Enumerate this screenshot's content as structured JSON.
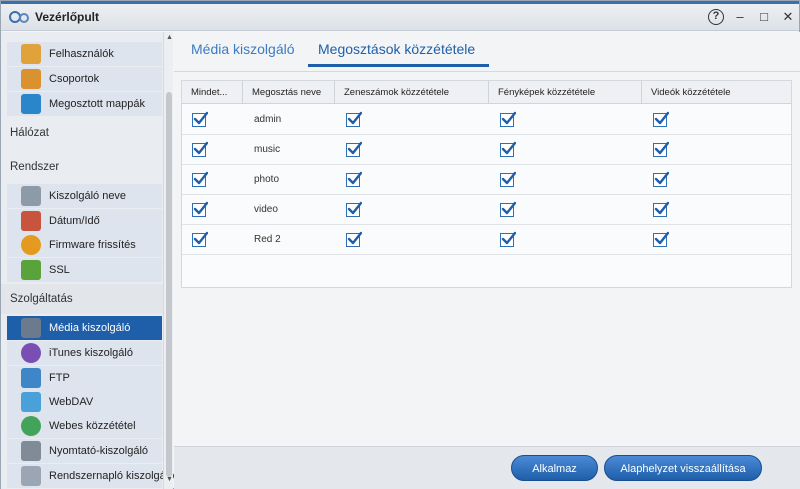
{
  "window": {
    "title": "Vezérlőpult"
  },
  "titlebar": {
    "help": "?",
    "minimize": "–",
    "maximize": "□",
    "close": "✕"
  },
  "sidebar": {
    "group_users": [
      {
        "label": "Felhasználók",
        "icon": "user-icon",
        "color": "#e0a23a"
      },
      {
        "label": "Csoportok",
        "icon": "group-icon",
        "color": "#d9922f"
      },
      {
        "label": "Megosztott mappák",
        "icon": "shared-folder-icon",
        "color": "#2a86c9"
      }
    ],
    "section_network": "Hálózat",
    "section_system": "Rendszer",
    "group_system": [
      {
        "label": "Kiszolgáló neve",
        "icon": "server-name-icon",
        "color": "#8d9aa8"
      },
      {
        "label": "Dátum/Idő",
        "icon": "calendar-icon",
        "color": "#c8533f"
      },
      {
        "label": "Firmware frissítés",
        "icon": "firmware-update-icon",
        "color": "#e39a1e"
      },
      {
        "label": "SSL",
        "icon": "ssl-certificate-icon",
        "color": "#5aa23a"
      }
    ],
    "section_services": "Szolgáltatás",
    "group_services": [
      {
        "label": "Média kiszolgáló",
        "icon": "media-server-icon",
        "color": "#6b7a8c",
        "active": true
      },
      {
        "label": "iTunes kiszolgáló",
        "icon": "itunes-icon",
        "color": "#7a4fb3"
      },
      {
        "label": "FTP",
        "icon": "ftp-icon",
        "color": "#3f86c8"
      },
      {
        "label": "WebDAV",
        "icon": "webdav-icon",
        "color": "#4aa0d8"
      },
      {
        "label": "Webes közzététel",
        "icon": "web-publishing-icon",
        "color": "#43a35a"
      },
      {
        "label": "Nyomtató-kiszolgáló",
        "icon": "printer-icon",
        "color": "#7f8b97"
      },
      {
        "label": "Rendszernapló kiszolgáló",
        "icon": "syslog-icon",
        "color": "#9aa6b3"
      }
    ]
  },
  "tabs": [
    {
      "label": "Média kiszolgáló"
    },
    {
      "label": "Megosztások közzététele"
    }
  ],
  "table": {
    "headers": [
      "Mindet...",
      "Megosztás neve",
      "Zeneszámok közzététele",
      "Fényképek közzététele",
      "Videók közzététele"
    ],
    "rows": [
      {
        "all": true,
        "name": "admin",
        "music": true,
        "photos": true,
        "videos": true
      },
      {
        "all": true,
        "name": "music",
        "music": true,
        "photos": true,
        "videos": true
      },
      {
        "all": true,
        "name": "photo",
        "music": true,
        "photos": true,
        "videos": true
      },
      {
        "all": true,
        "name": "video",
        "music": true,
        "photos": true,
        "videos": true
      },
      {
        "all": true,
        "name": "Red 2",
        "music": true,
        "photos": true,
        "videos": true
      }
    ]
  },
  "footer": {
    "apply_label": "Alkalmaz",
    "reset_label": "Alaphelyzet visszaállítása"
  },
  "colors": {
    "accent": "#1f5ea8",
    "tab_text": "#3b7bc2"
  }
}
